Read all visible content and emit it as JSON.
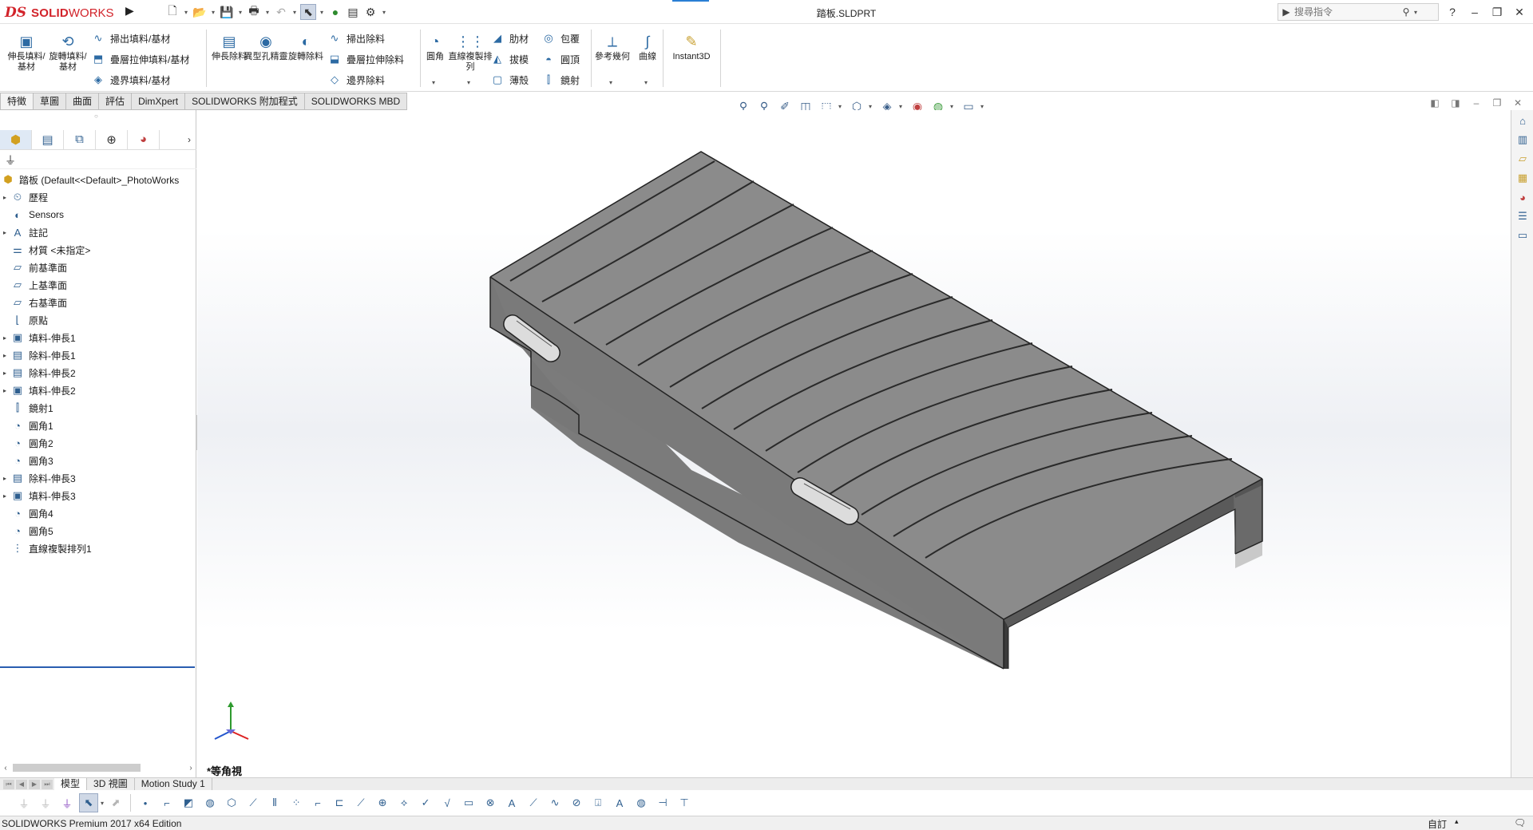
{
  "app": {
    "logo_ds": "DS",
    "logo_solid": "SOLID",
    "logo_works": "WORKS",
    "window_title": "踏板.SLDPRT",
    "search_placeholder": "搜尋指令",
    "help_label": "?"
  },
  "quick_access": {
    "icons": [
      "new-icon",
      "open-icon",
      "save-icon",
      "print-icon",
      "undo-icon",
      "select-icon",
      "rebuild-icon",
      "file-properties-icon",
      "options-icon"
    ]
  },
  "command_manager": {
    "extrude_boss": "伸長填料/基材",
    "revolve_boss": "旋轉填料/基材",
    "sweep_boss": "掃出填料/基材",
    "loft_boss": "疊層拉伸填料/基材",
    "boundary_boss": "邊界填料/基材",
    "extrude_cut": "伸長除料",
    "hole_wizard": "異型孔精靈",
    "revolve_cut": "旋轉除料",
    "sweep_cut": "掃出除料",
    "loft_cut": "疊層拉伸除料",
    "boundary_cut": "邊界除料",
    "fillet": "圓角",
    "linear_pattern": "直線複製排列",
    "rib": "肋材",
    "draft": "拔模",
    "shell": "薄殼",
    "wrap": "包覆",
    "dome": "圓頂",
    "mirror": "鏡射",
    "ref_geometry": "參考幾何",
    "curves": "曲線",
    "instant3d": "Instant3D"
  },
  "tabs": [
    "特徵",
    "草圖",
    "曲面",
    "評估",
    "DimXpert",
    "SOLIDWORKS 附加程式",
    "SOLIDWORKS MBD"
  ],
  "feature_tree": {
    "root": "踏板  (Default<<Default>_PhotoWorks",
    "items": [
      {
        "label": "歷程",
        "icon": "history-folder-icon",
        "expand": true
      },
      {
        "label": "Sensors",
        "icon": "sensors-icon",
        "expand": false
      },
      {
        "label": "註記",
        "icon": "annotations-icon",
        "expand": true
      },
      {
        "label": "材質 <未指定>",
        "icon": "material-icon",
        "expand": false
      },
      {
        "label": "前基準面",
        "icon": "plane-icon",
        "expand": false
      },
      {
        "label": "上基準面",
        "icon": "plane-icon",
        "expand": false
      },
      {
        "label": "右基準面",
        "icon": "plane-icon",
        "expand": false
      },
      {
        "label": "原點",
        "icon": "origin-icon",
        "expand": false
      },
      {
        "label": "填料-伸長1",
        "icon": "extrude-icon",
        "expand": true
      },
      {
        "label": "除料-伸長1",
        "icon": "cut-extrude-icon",
        "expand": true
      },
      {
        "label": "除料-伸長2",
        "icon": "cut-extrude-icon",
        "expand": true
      },
      {
        "label": "填料-伸長2",
        "icon": "extrude-icon",
        "expand": true
      },
      {
        "label": "鏡射1",
        "icon": "mirror-icon",
        "expand": false
      },
      {
        "label": "圓角1",
        "icon": "fillet-icon",
        "expand": false
      },
      {
        "label": "圓角2",
        "icon": "fillet-icon",
        "expand": false
      },
      {
        "label": "圓角3",
        "icon": "fillet-icon",
        "expand": false
      },
      {
        "label": "除料-伸長3",
        "icon": "cut-extrude-icon",
        "expand": true
      },
      {
        "label": "填料-伸長3",
        "icon": "extrude-icon",
        "expand": true
      },
      {
        "label": "圓角4",
        "icon": "fillet-icon",
        "expand": false
      },
      {
        "label": "圓角5",
        "icon": "fillet-icon",
        "expand": false
      },
      {
        "label": "直線複製排列1",
        "icon": "linear-pattern-icon",
        "expand": false
      }
    ]
  },
  "viewport": {
    "view_name": "*等角視"
  },
  "bottom_tabs": [
    "模型",
    "3D 視圖",
    "Motion Study 1"
  ],
  "status": {
    "edition": "SOLIDWORKS Premium 2017 x64 Edition",
    "units": "自訂"
  },
  "colors": {
    "brand_red": "#d2232a",
    "accent_blue": "#2a7fd4",
    "part_top": "#8a8a8a",
    "part_side": "#767676",
    "part_dark": "#3a3a3a"
  }
}
